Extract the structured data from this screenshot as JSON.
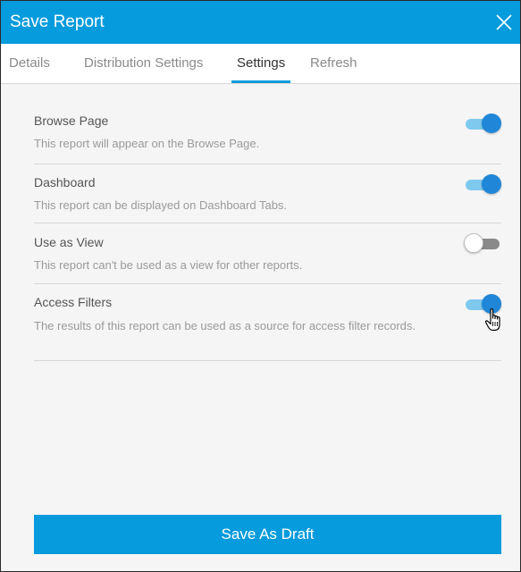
{
  "dialog": {
    "title": "Save Report",
    "close_icon": "close-icon"
  },
  "tabs": [
    {
      "label": "Details",
      "active": false
    },
    {
      "label": "Distribution Settings",
      "active": false
    },
    {
      "label": "Settings",
      "active": true
    },
    {
      "label": "Refresh",
      "active": false
    }
  ],
  "settings": [
    {
      "title": "Browse Page",
      "description": "This report will appear on the Browse Page.",
      "enabled": true
    },
    {
      "title": "Dashboard",
      "description": "This report can be displayed on Dashboard Tabs.",
      "enabled": true
    },
    {
      "title": "Use as View",
      "description": "This report can't be used as a view for other reports.",
      "enabled": false
    },
    {
      "title": "Access Filters",
      "description": "The results of this report can be used as a source for access filter records.",
      "enabled": true
    }
  ],
  "footer": {
    "save_label": "Save As Draft"
  },
  "colors": {
    "accent": "#069bdc",
    "toggle_on_knob": "#1f86d8",
    "toggle_on_track": "#7fc9ee",
    "toggle_off_track": "#8a8a8a"
  }
}
